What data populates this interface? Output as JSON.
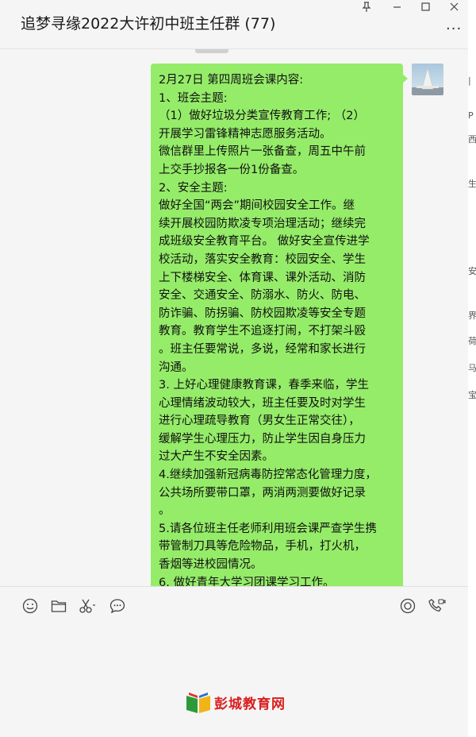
{
  "window": {
    "title": "追梦寻缘2022大许初中班主任群 (77)",
    "controls": [
      "pin-icon",
      "minimize-icon",
      "maximize-icon",
      "close-icon"
    ],
    "more_label": "···"
  },
  "message": {
    "sender": "self",
    "bubble_color": "#95ec69",
    "lines": [
      "2月27日  第四周班会课内容:",
      "1、班会主题:",
      "  （1）做好垃圾分类宣传教育工作;    （2）",
      "开展学习雷锋精神志愿服务活动。",
      "微信群里上传照片一张备查，周五中午前",
      "上交手抄报各一份1份备查。",
      "2、安全主题:",
      "做好全国“两会”期间校园安全工作。继",
      "续开展校园防欺凌专项治理活动；继续完",
      "成班级安全教育平台。 做好安全宣传进学",
      "校活动，落实安全教育：校园安全、学生",
      "上下楼梯安全、体育课、课外活动、消防",
      "安全、交通安全、防溺水、防火、防电、",
      "防诈骗、防拐骗、防校园欺凌等安全专题",
      "教育。教育学生不追逐打闹，不打架斗殴",
      "。班主任要常说，多说，经常和家长进行",
      "沟通。",
      "3. 上好心理健康教育课，春季来临，学生",
      "心理情绪波动较大，班主任要及时对学生",
      "进行心理疏导教育（男女生正常交往），",
      "缓解学生心理压力，防止学生因自身压力",
      "过大产生不安全因素。",
      "4.继续加强新冠病毒防控常态化管理力度，",
      "公共场所要带口罩，两消两测要做好记录",
      "。",
      "5.请各位班主任老师利用班会课严查学生携",
      "带管制刀具等危险物品，手机，打火机，",
      "香烟等进校园情况。",
      "6. 做好青年大学习团课学习工作。"
    ]
  },
  "input_toolbar": {
    "left_tools": [
      "emoji-icon",
      "folder-icon",
      "screenshot-scissors-icon",
      "chat-history-icon"
    ],
    "right_tools": [
      "live-icon",
      "voice-video-call-icon"
    ]
  },
  "edge_glyphs": [
    "|",
    "P",
    "西",
    "生",
    "安",
    "界",
    "荷",
    "马",
    "宝"
  ],
  "watermark": {
    "text": "彭城教育网",
    "text_color": "#d81e1e"
  }
}
